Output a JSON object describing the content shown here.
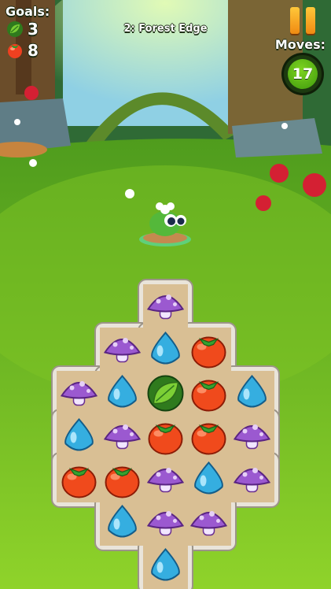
{
  "hud": {
    "goals_label": "Goals:",
    "goals": [
      {
        "icon": "leaf-icon",
        "count": "3"
      },
      {
        "icon": "tomato-icon",
        "count": "8"
      }
    ],
    "level_title": "2: Forest Edge",
    "moves_label": "Moves:",
    "moves_value": "17",
    "pause_icon": "pause-icon"
  },
  "board": {
    "columns": 5,
    "rows": 7,
    "layout": [
      [
        null,
        null,
        "mushroom",
        null,
        null
      ],
      [
        null,
        "mushroom",
        "drop",
        "tomato",
        null
      ],
      [
        "mushroom",
        "drop",
        "leaf",
        "tomato",
        "drop"
      ],
      [
        "drop",
        "mushroom",
        "tomato",
        "tomato",
        "mushroom"
      ],
      [
        "tomato",
        "tomato",
        "mushroom",
        "drop",
        "mushroom"
      ],
      [
        null,
        "drop",
        "mushroom",
        "mushroom",
        null
      ],
      [
        null,
        null,
        "drop",
        null,
        null
      ]
    ]
  },
  "colors": {
    "mushroom": "#9b59d0",
    "drop": "#35aee0",
    "tomato": "#f04a1c",
    "leaf": "#3f9e2b",
    "tray": "#d9bf94",
    "frame": "#e9e4da"
  }
}
